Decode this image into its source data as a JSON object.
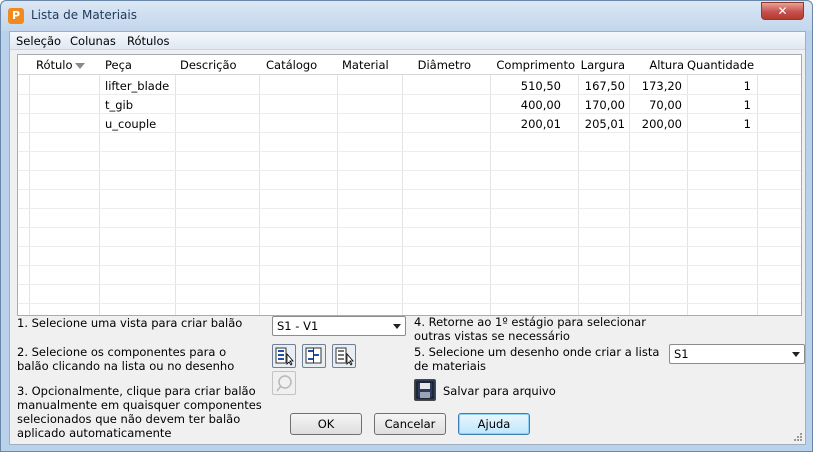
{
  "window": {
    "title": "Lista de Materiais",
    "app_icon_letter": "P",
    "close_label": "✕"
  },
  "menu": [
    "Seleção",
    "Colunas",
    "Rótulos"
  ],
  "table": {
    "columns": [
      "Rótulo",
      "Peça",
      "Descrição",
      "Catálogo",
      "Material",
      "Diâmetro",
      "Comprimento",
      "Largura",
      "Altura",
      "Quantidade"
    ],
    "rows": [
      {
        "rotulo": "",
        "peca": "lifter_blade",
        "descricao": "",
        "catalogo": "",
        "material": "",
        "diametro": "",
        "comprimento": "510,50",
        "largura": "167,50",
        "altura": "173,20",
        "quantidade": "1"
      },
      {
        "rotulo": "",
        "peca": "t_gib",
        "descricao": "",
        "catalogo": "",
        "material": "",
        "diametro": "",
        "comprimento": "400,00",
        "largura": "170,00",
        "altura": "70,00",
        "quantidade": "1"
      },
      {
        "rotulo": "",
        "peca": "u_couple",
        "descricao": "",
        "catalogo": "",
        "material": "",
        "diametro": "",
        "comprimento": "200,01",
        "largura": "205,01",
        "altura": "200,00",
        "quantidade": "1"
      }
    ]
  },
  "steps": {
    "step1": "1. Selecione uma vista para criar balão",
    "step2": "2. Selecione os componentes para o balão clicando na lista ou no desenho",
    "step3": "3. Opcionalmente, clique para criar balão manualmente em quaisquer componentes selecionados que não devem ter balão aplicado automaticamente",
    "step4": "4. Retorne ao 1º estágio para selecionar outras vistas se necessário",
    "step5": "5. Selecione um desenho onde criar a lista de materiais"
  },
  "view_select": {
    "value": "S1 - V1"
  },
  "drawing_select": {
    "value": "S1"
  },
  "tool_icons": [
    "select-all-rows-icon",
    "select-mixed-rows-icon",
    "select-rows-cursor-icon",
    "manual-balloon-icon",
    "save-floppy-icon"
  ],
  "save_label": "Salvar para arquivo",
  "buttons": {
    "ok": "OK",
    "cancel": "Cancelar",
    "help": "Ajuda"
  },
  "colors": {
    "title_bg": "#c3d6ec",
    "close": "#c75050",
    "default_button": "#3c7fb1"
  }
}
